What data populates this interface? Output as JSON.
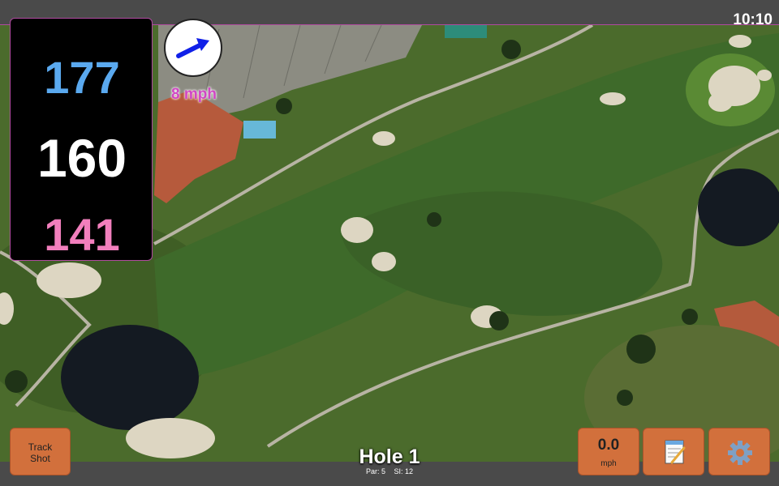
{
  "status_bar": {
    "time": "10:10"
  },
  "distances": {
    "back": "177",
    "middle": "160",
    "front": "141"
  },
  "wind": {
    "speed_label": "8 mph",
    "direction_icon": "arrow-right-icon"
  },
  "hole": {
    "title": "Hole 1",
    "par_label": "Par: 5",
    "si_label": "SI: 12"
  },
  "buttons": {
    "track_shot_line1": "Track",
    "track_shot_line2": "Shot",
    "speed_value": "0.0",
    "speed_unit": "mph",
    "notes_icon": "notepad-icon",
    "settings_icon": "gear-icon"
  },
  "colors": {
    "back_distance": "#5aa9ef",
    "middle_distance": "#ffffff",
    "front_distance": "#f27fbd",
    "wind_label": "#d147c4",
    "button": "#d2703c"
  }
}
